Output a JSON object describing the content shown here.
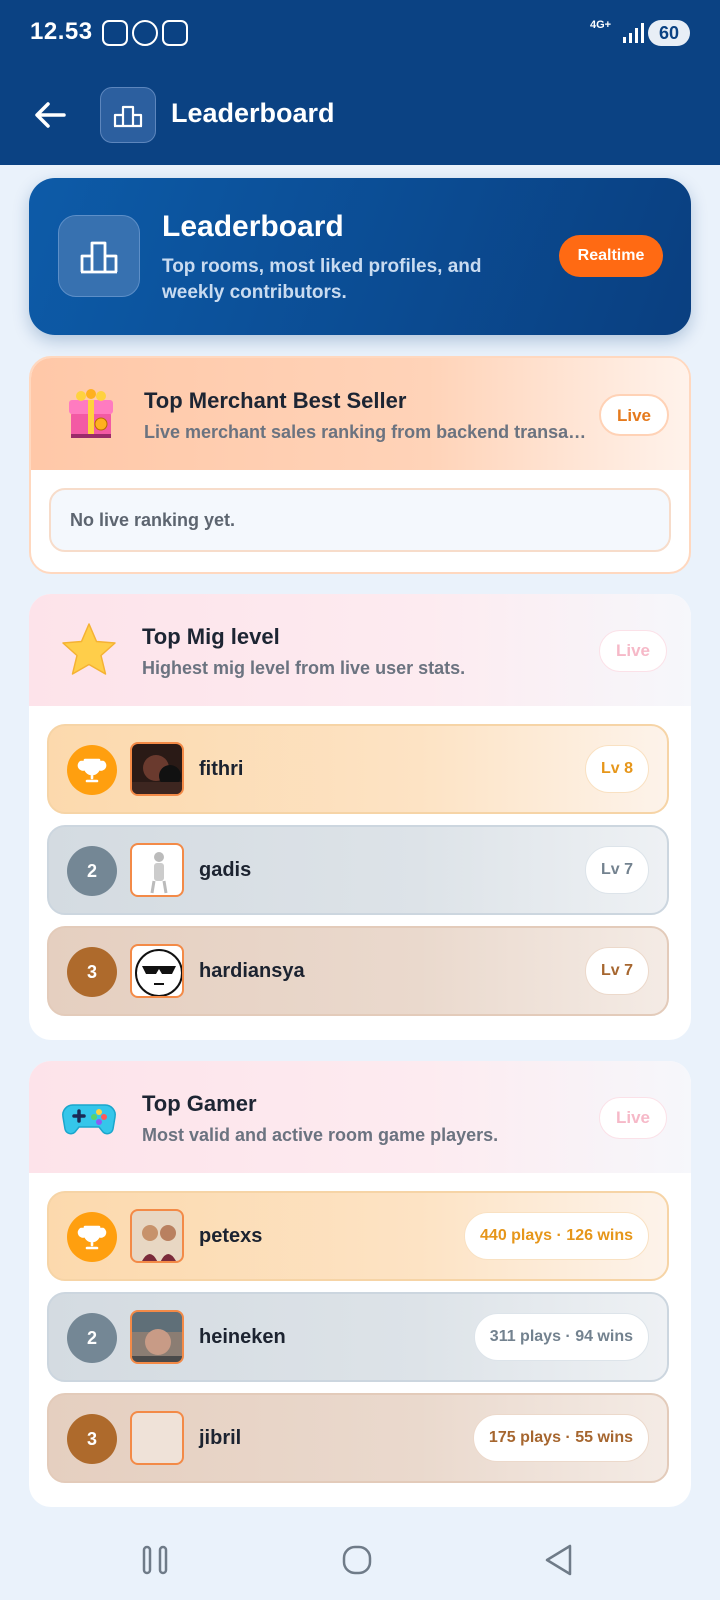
{
  "status": {
    "time": "12.53",
    "network": "4G+",
    "battery": "60"
  },
  "appbar": {
    "title": "Leaderboard"
  },
  "hero": {
    "title": "Leaderboard",
    "subtitle": "Top rooms, most liked profiles, and weekly contributors.",
    "badge": "Realtime"
  },
  "sections": [
    {
      "title": "Top Merchant Best Seller",
      "subtitle": "Live merchant sales ranking from backend transactions",
      "badge": "Live",
      "empty_text": "No live ranking yet."
    },
    {
      "title": "Top Mig level",
      "subtitle": "Highest mig level from live user stats.",
      "badge": "Live",
      "rows": [
        {
          "rank": "",
          "name": "fithri",
          "stat": "Lv 8"
        },
        {
          "rank": "2",
          "name": "gadis",
          "stat": "Lv 7"
        },
        {
          "rank": "3",
          "name": "hardiansya",
          "stat": "Lv 7"
        }
      ]
    },
    {
      "title": "Top Gamer",
      "subtitle": "Most valid and active room game players.",
      "badge": "Live",
      "rows": [
        {
          "rank": "",
          "name": "petexs",
          "stat": "440 plays · 126 wins"
        },
        {
          "rank": "2",
          "name": "heineken",
          "stat": "311 plays · 94 wins"
        },
        {
          "rank": "3",
          "name": "jibril",
          "stat": "175 plays · 55 wins"
        }
      ]
    }
  ],
  "icons": {
    "back": "arrow-left-icon",
    "leaderboard": "podium-icon",
    "merchant": "gift-box-icon",
    "mig": "star-icon",
    "gamer": "gamepad-icon",
    "first_place": "trophy-icon"
  },
  "colors": {
    "primary": "#0b4283",
    "accent": "#ff6a13",
    "gold": "#ff9f0f",
    "silver": "#748795",
    "bronze": "#ae6a2c"
  }
}
